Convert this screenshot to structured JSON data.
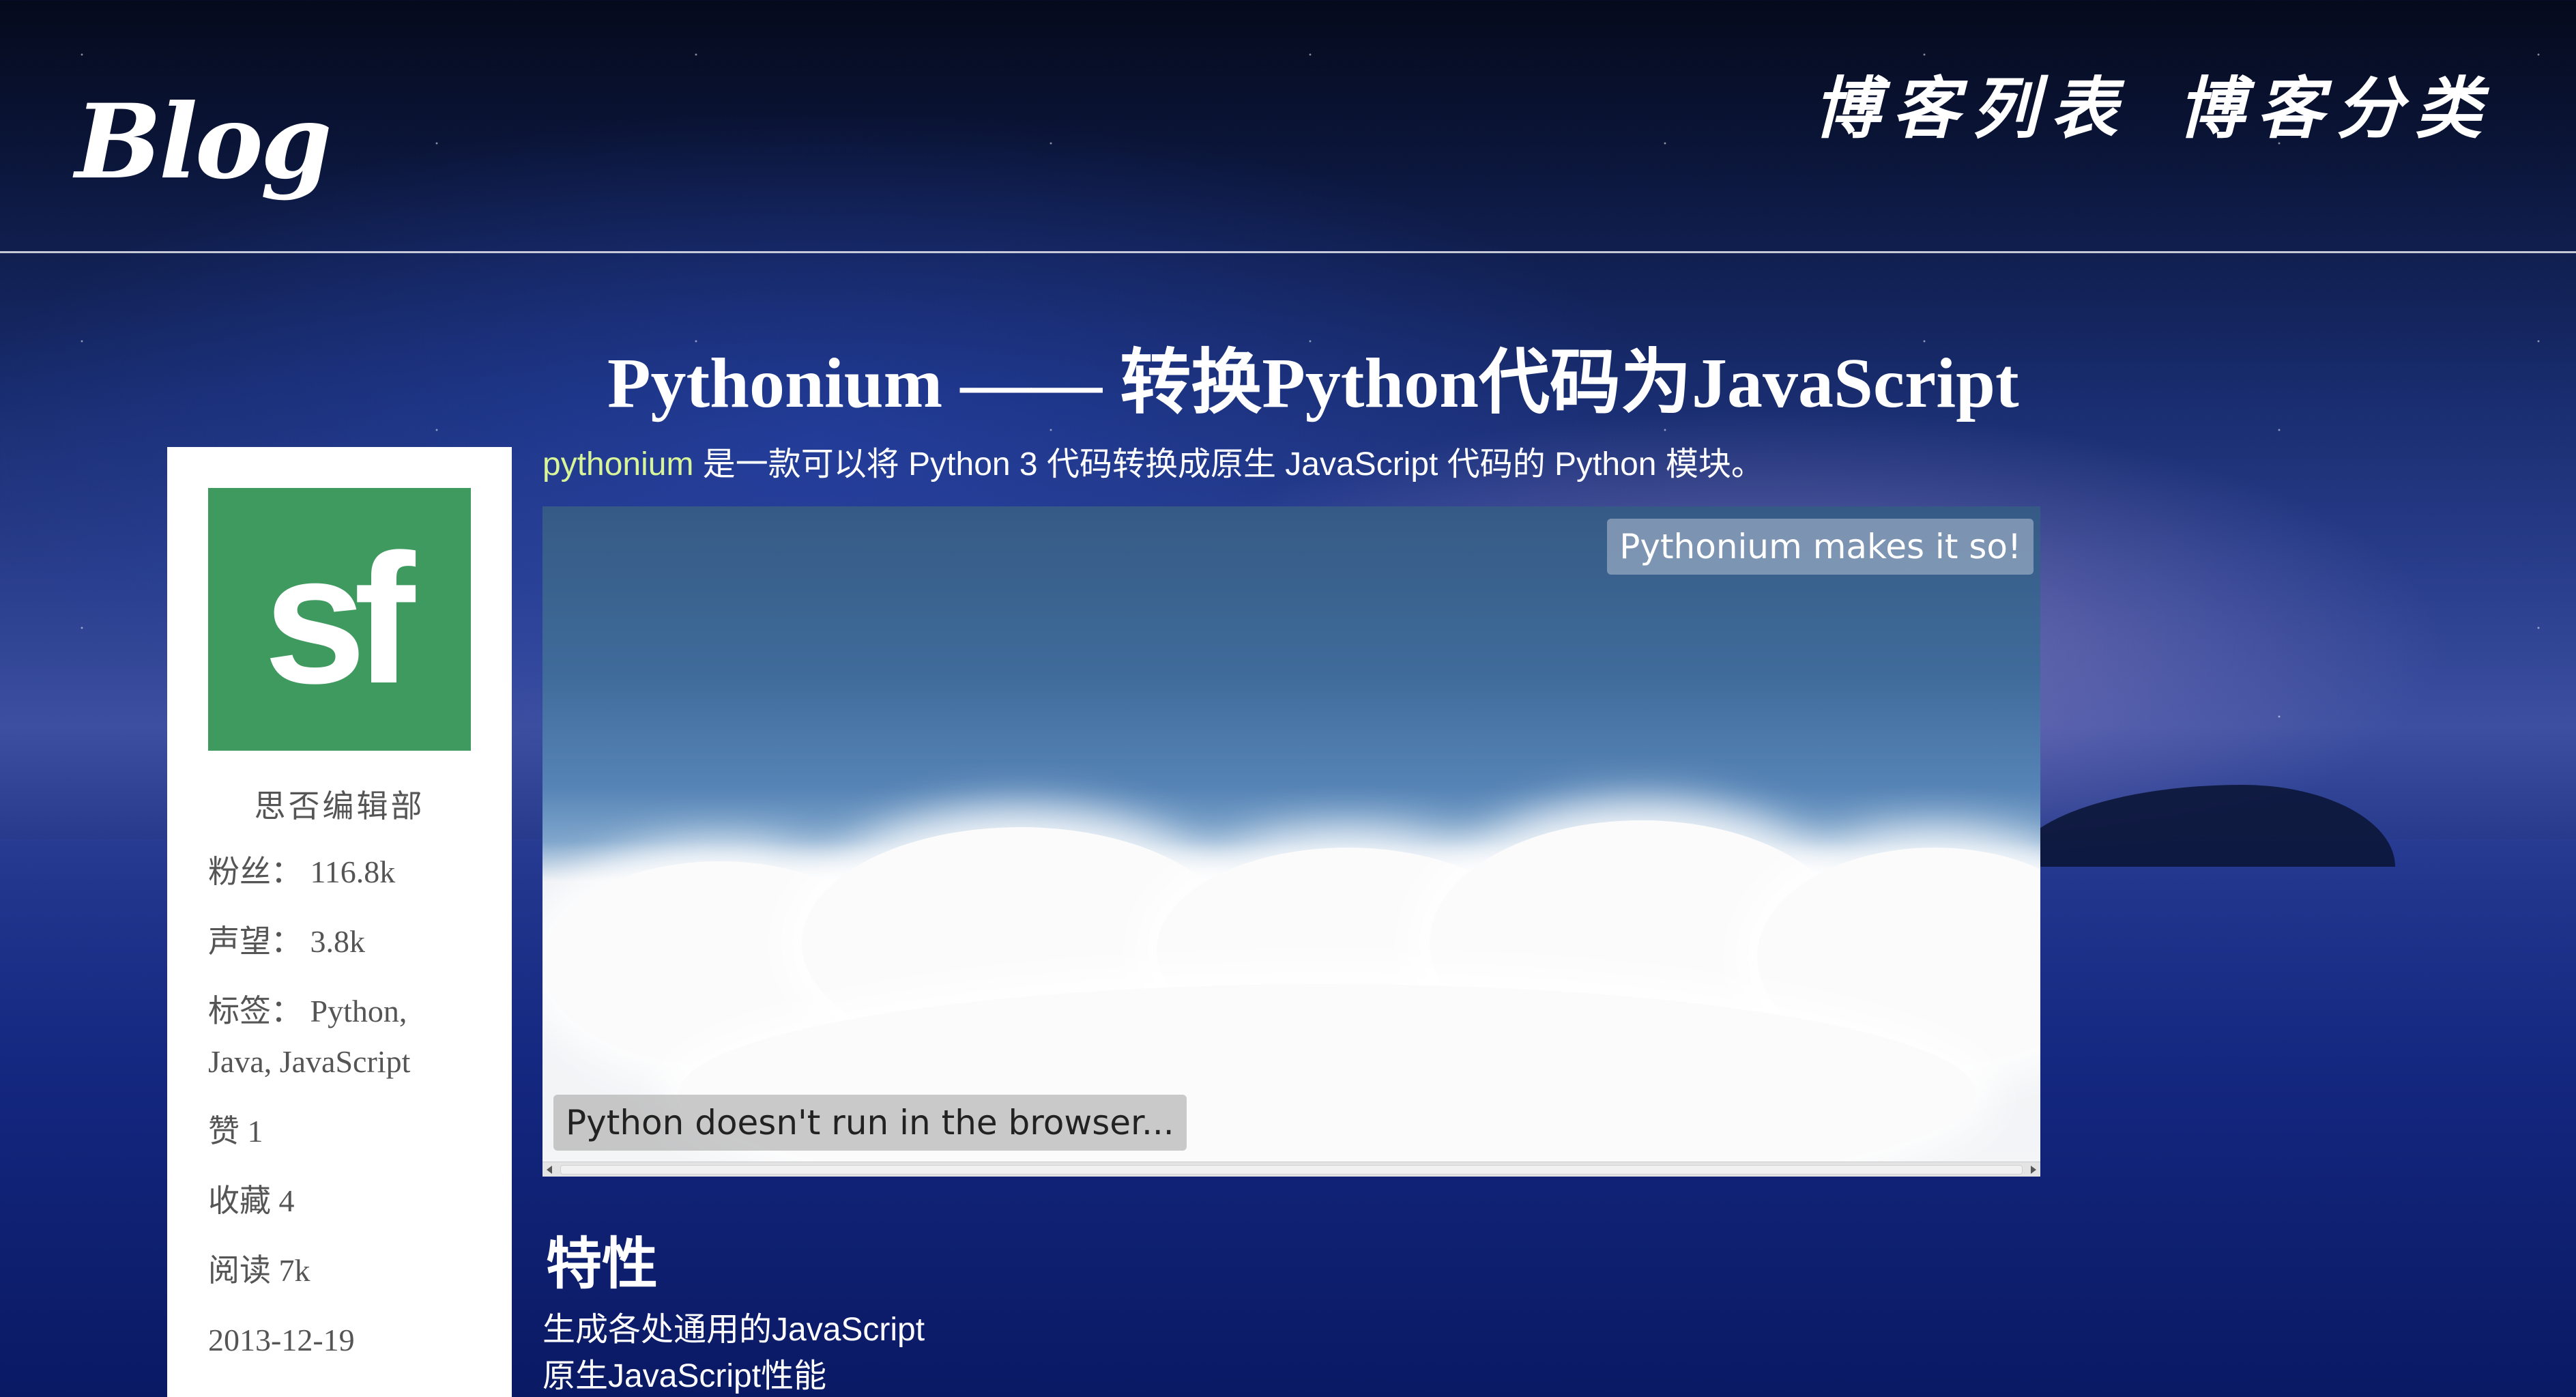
{
  "header": {
    "brand": "Blog",
    "nav": [
      {
        "label": "博客列表"
      },
      {
        "label": "博客分类"
      }
    ]
  },
  "sidebar": {
    "avatar_text": "sf",
    "author": "思否编辑部",
    "fans": "粉丝： 116.8k",
    "reputation": "声望： 3.8k",
    "tags": "标签： Python, Java, JavaScript",
    "likes": "赞 1",
    "favorites": "收藏 4",
    "reads": "阅读 7k",
    "date": "2013-12-19"
  },
  "article": {
    "title": "Pythonium —— 转换Python代码为JavaScript",
    "intro_link": "pythonium",
    "intro_rest": " 是一款可以将 Python 3 代码转换成原生 JavaScript 代码的 Python 模块。",
    "frame": {
      "badge_top": "Pythonium makes it so!",
      "badge_bottom": "Python doesn't run in the browser..."
    },
    "section_heading": "特性",
    "features": [
      "生成各处通用的JavaScript",
      "原生JavaScript性能"
    ]
  },
  "colors": {
    "avatar_bg": "#3f9a5f",
    "link": "#d8f59a"
  }
}
